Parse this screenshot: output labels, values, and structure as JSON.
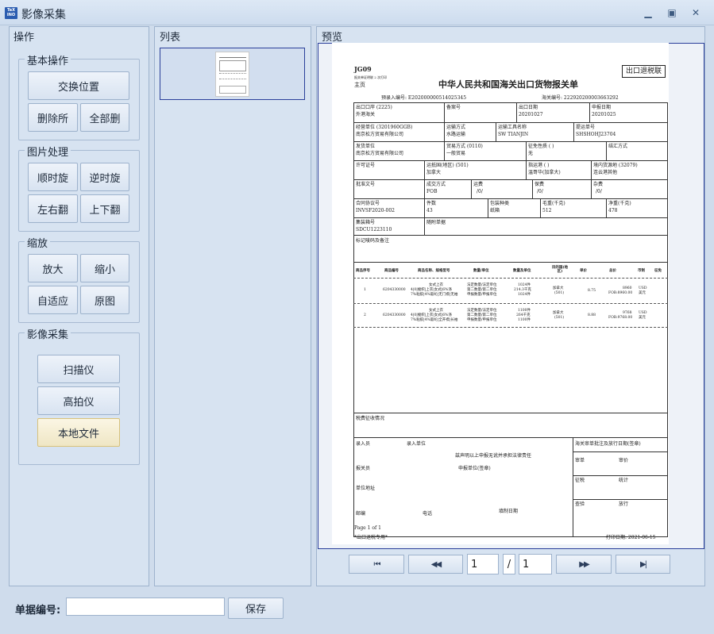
{
  "window": {
    "title": "影像采集",
    "app_icon_text": "TeX INO"
  },
  "operations": {
    "title": "操作",
    "basic": {
      "legend": "基本操作",
      "swap": "交换位置",
      "delete_one": "删除所",
      "delete_all": "全部删"
    },
    "image": {
      "legend": "图片处理",
      "cw": "顺时旋",
      "ccw": "逆时旋",
      "flip_lr": "左右翻",
      "flip_ud": "上下翻"
    },
    "zoom": {
      "legend": "缩放",
      "zoom_in": "放大",
      "zoom_out": "缩小",
      "fit": "自适应",
      "original": "原图"
    },
    "capture": {
      "legend": "影像采集",
      "scanner": "扫描仪",
      "camera": "高拍仪",
      "local": "本地文件"
    }
  },
  "list": {
    "title": "列表"
  },
  "preview": {
    "title": "预览"
  },
  "pager": {
    "first": "⏮",
    "prev": "◀◀",
    "current": "1",
    "sep": "/",
    "total": "1",
    "next": "▶▶",
    "last": "▶|"
  },
  "footer": {
    "doc_no_label": "单据编号:",
    "doc_no_value": "",
    "save": "保存"
  },
  "document": {
    "code": "JG09",
    "code_sub": "报关单证明联  2  次打印",
    "stamp": "出口退税联",
    "title": "中华人民共和国海关出口货物报关单",
    "page_label": "主页",
    "pre_no": "预录入编号: E202000000514025345",
    "customs_no": "海关编号: 222920200003663292",
    "cells": {
      "exit_port": "出口口岸  (2225)",
      "exit_port_v": "外港海关",
      "record_no": "备案号",
      "export_date": "出口日期",
      "export_date_v": "20201027",
      "declare_date": "申报日期",
      "declare_date_v": "20201025",
      "operator": "经营单位  (3201960GGB)",
      "operator_v": "南京松方贸易有限公司",
      "transport": "运输方式",
      "transport_v": "水路运输",
      "vehicle": "运输工具名称",
      "vehicle_v": "SW TIANJIN",
      "bill": "提运单号",
      "bill_v": "SHSHOHJ23704",
      "consignor": "发货单位",
      "consignor_v": "南京松方贸易有限公司",
      "trade": "贸易方式  (0110)",
      "trade_v": "一般贸易",
      "tax_nature": "征免性质  (  )",
      "tax_nature_v": "无",
      "settle": "结汇方式",
      "license": "许可证号",
      "country": "运抵国(地区)  (501)",
      "country_v": "加拿大",
      "port_dest": "指运港  (  )",
      "port_dest_v": "温哥华(加拿大)",
      "domestic": "境内货源地  (32079)",
      "domestic_v": "连云港其他",
      "approval": "批准文号",
      "deal": "成交方式",
      "deal_v": "FOB",
      "freight": "运费",
      "freight_v": "/0/",
      "insurance": "保费",
      "insurance_v": "/0/",
      "misc": "杂费",
      "misc_v": "/0/",
      "contract": "合同协议号",
      "contract_v": "INVSF2020-002",
      "pieces": "件数",
      "pieces_v": "43",
      "pack": "包装种类",
      "pack_v": "纸箱",
      "gross": "毛重(千克)",
      "gross_v": "512",
      "net": "净重(千克)",
      "net_v": "478",
      "container": "集装箱号",
      "container_v": "SDCU1223110",
      "docs": "随附单据",
      "marks": "标记唛码及备注",
      "tax_status": "税费征收情况",
      "entry": "录入员",
      "entry_unit": "录入单位",
      "statement": "兹声明以上申报无讹并承担法律责任",
      "approval_date": "海关审单批注及放行日期(签章)",
      "review": "审单",
      "examine": "审价",
      "declarer": "报关员",
      "declare_unit": "申报单位(签章)",
      "levy": "征税",
      "stat": "统计",
      "unit_addr": "单位地址",
      "inspect": "查验",
      "release": "放行",
      "postcode": "邮编",
      "phone": "电话",
      "fill_date": "填制日期"
    },
    "items_header": [
      "商品序号",
      "商品编号",
      "商品名称、规格型号",
      "数量/单位",
      "数量及单位",
      "目的国(地区)",
      "单价",
      "总价",
      "币制",
      "征免"
    ],
    "items": [
      {
        "seq": "1",
        "code": "6204330000",
        "name1": "女式上衣",
        "name2": "4|0|梭织|上衣|女式|6%涤",
        "name3": "7%粘胶|4%氨纶|无门襟|无袖",
        "qty1": "法定数量/法定单位",
        "qty2": "第二数量/第二单位",
        "qty3": "申报数量/申报单位",
        "amt1": "1024件",
        "amt2": "214.3千克",
        "amt3": "1024件",
        "dest1": "加拿大",
        "dest2": "(501)",
        "price": "8.75",
        "total1": "8960",
        "total2": "FOB:8960.00",
        "cur1": "USD",
        "cur2": "美元"
      },
      {
        "seq": "2",
        "code": "6204330000",
        "name1": "女式上衣",
        "name2": "4|0|梭织|上衣|女式|6%涤",
        "name3": "7%粘胶|4%氨纶|全开襟|长袖",
        "qty1": "法定数量/法定单位",
        "qty2": "第二数量/第二单位",
        "qty3": "申报数量/申报单位",
        "amt1": "1100件",
        "amt2": "264千克",
        "amt3": "1100件",
        "dest1": "加拿大",
        "dest2": "(501)",
        "price": "8.88",
        "total1": "9768",
        "total2": "FOB:9768.00",
        "cur1": "USD",
        "cur2": "美元"
      }
    ],
    "page_info": "Page    1 of 1",
    "footnote": "*出口退税专用*",
    "print_date": "打印日期: 2021-06-15"
  }
}
